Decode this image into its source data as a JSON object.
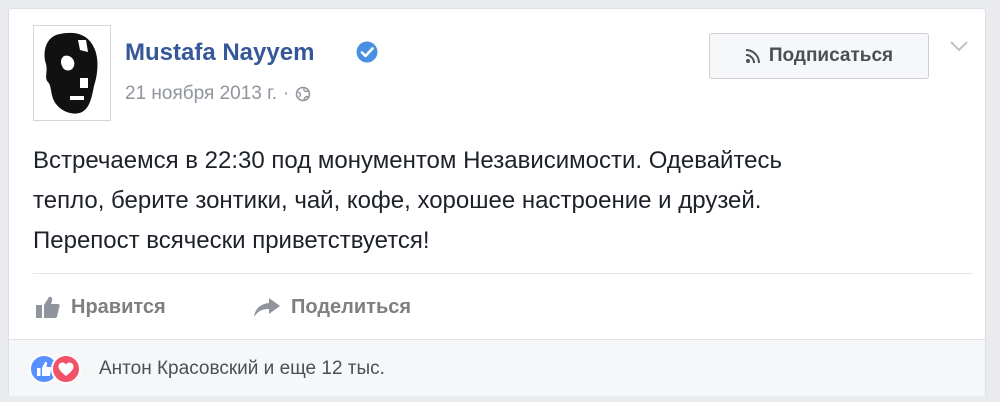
{
  "post": {
    "author": "Mustafa Nayyem",
    "verified_icon": "verified-check-icon",
    "date": "21 ноября 2013 г.",
    "separator": "·",
    "privacy_icon": "globe-icon",
    "text_lines": [
      "Встречаемся в 22:30 под монументом Независимости. Одевайтесь",
      "тепло, берите зонтики, чай, кофе, хорошее настроение и друзей.",
      "Перепост всячески приветствуется!"
    ]
  },
  "header": {
    "follow_label": "Подписаться",
    "follow_icon": "rss-icon",
    "menu_icon": "chevron-down-icon"
  },
  "actions": {
    "like_label": "Нравится",
    "like_icon": "thumbs-up-icon",
    "share_label": "Поделиться",
    "share_icon": "share-arrow-icon"
  },
  "reactions": {
    "icons": [
      "like-reaction-icon",
      "love-reaction-icon"
    ],
    "summary": "Антон Красовский и еще 12 тыс."
  },
  "colors": {
    "author_blue": "#365899",
    "like_blue": "#5890ff",
    "love_red": "#f25268",
    "muted_gray": "#90949c"
  }
}
